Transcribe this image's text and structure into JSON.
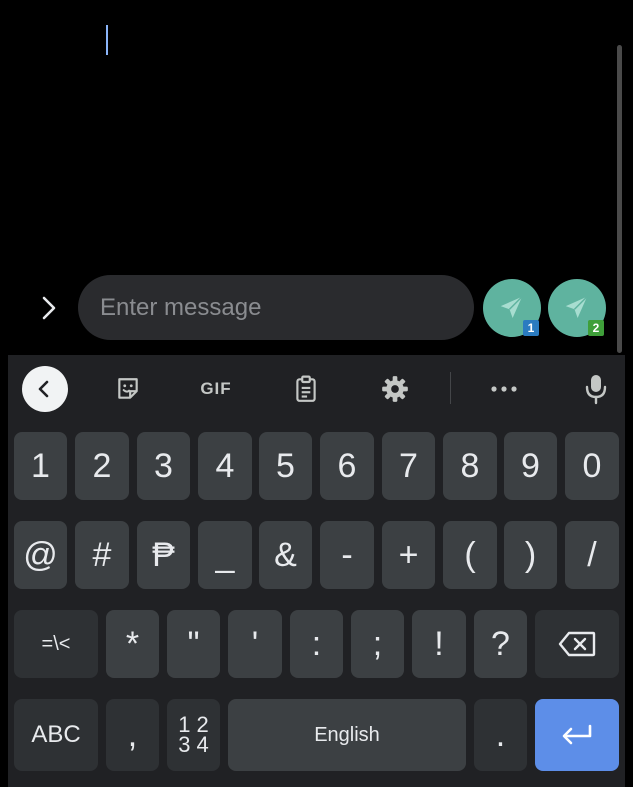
{
  "compose": {
    "placeholder": "Enter message",
    "sim1_badge": "1",
    "sim2_badge": "2"
  },
  "toolbar": {
    "gif_label": "GIF"
  },
  "keyboard": {
    "row1": [
      "1",
      "2",
      "3",
      "4",
      "5",
      "6",
      "7",
      "8",
      "9",
      "0"
    ],
    "row2": [
      "@",
      "#",
      "₱",
      "_",
      "&",
      "-",
      "+",
      "(",
      ")",
      "/"
    ],
    "row3": [
      "=\\<",
      "*",
      "\"",
      "'",
      ":",
      ";",
      "!",
      "?"
    ],
    "bottom": {
      "abc": "ABC",
      "comma": ",",
      "numpad_top": "1 2",
      "numpad_bottom": "3 4",
      "space": "English",
      "period": "."
    }
  },
  "colors": {
    "send_button": "#5fb39f",
    "sim1_badge": "#2b7bc0",
    "sim2_badge": "#3f9f3a",
    "enter_key": "#5d8ee8",
    "key": "#3c4043",
    "keyboard_bg": "#202124"
  },
  "icons": {
    "expand": "chevron-right-icon",
    "send": "paper-plane-icon",
    "collapse": "chevron-left-icon",
    "sticker": "sticker-icon",
    "clipboard": "clipboard-icon",
    "settings": "gear-icon",
    "more": "more-horizontal-icon",
    "voice": "microphone-icon",
    "backspace": "backspace-icon",
    "enter": "enter-icon"
  }
}
